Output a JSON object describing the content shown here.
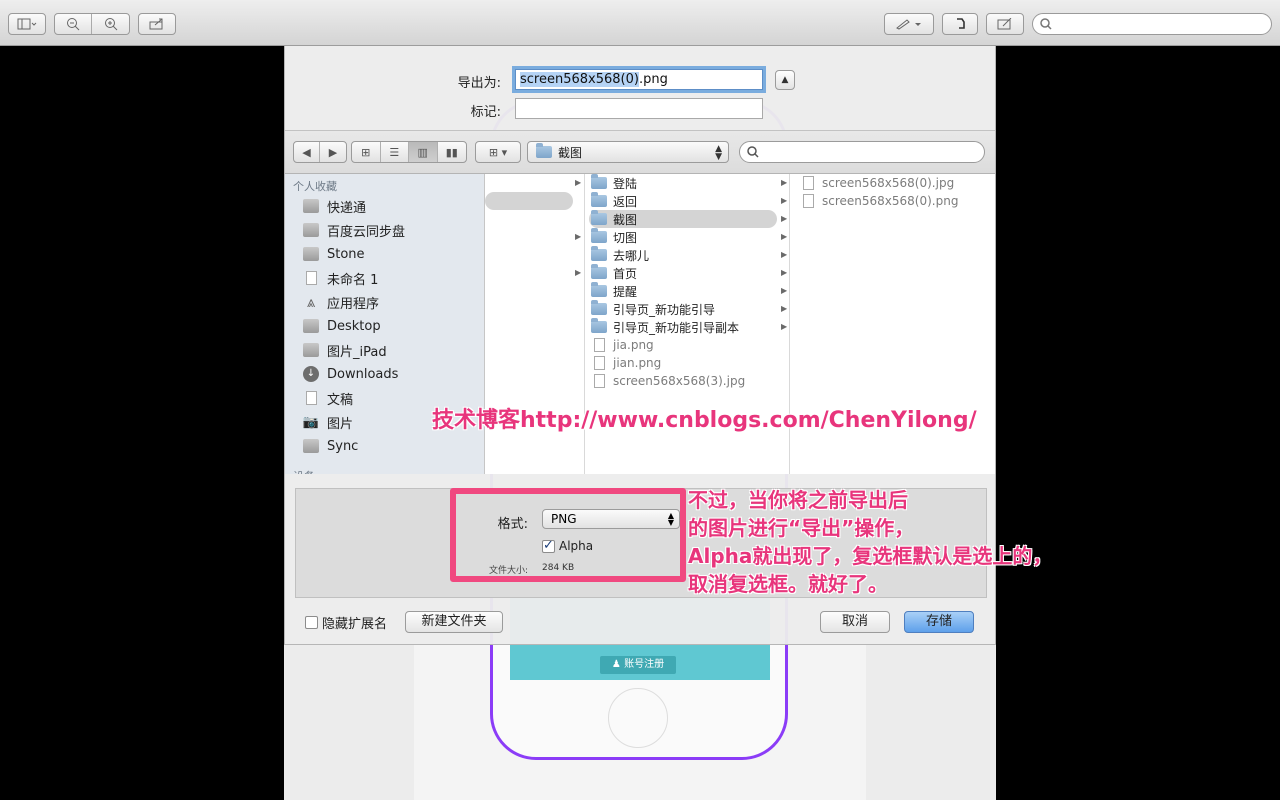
{
  "toolbar": {
    "buttons": [
      "sidebar-toggle",
      "zoom-out",
      "zoom-in",
      "share",
      "markup",
      "rotate",
      "annotate"
    ]
  },
  "sheet": {
    "save_as_label": "导出为:",
    "save_as_selected": "screen568x568(0)",
    "save_as_rest": ".png",
    "tags_label": "标记:",
    "tags_value": "",
    "path": "截图",
    "sidebar": {
      "favorites_header": "个人收藏",
      "devices_header": "设备",
      "items": [
        {
          "label": "快递通",
          "icon": "folder-icon"
        },
        {
          "label": "百度云同步盘",
          "icon": "folder-icon"
        },
        {
          "label": "Stone",
          "icon": "folder-icon"
        },
        {
          "label": "未命名 1",
          "icon": "document-icon"
        },
        {
          "label": "应用程序",
          "icon": "applications-icon"
        },
        {
          "label": "Desktop",
          "icon": "desktop-icon"
        },
        {
          "label": "图片_iPad",
          "icon": "folder-icon"
        },
        {
          "label": "Downloads",
          "icon": "downloads-icon"
        },
        {
          "label": "文稿",
          "icon": "documents-icon"
        },
        {
          "label": "图片",
          "icon": "camera-icon"
        },
        {
          "label": "Sync",
          "icon": "folder-icon"
        }
      ]
    },
    "column2": [
      {
        "label": "登陆",
        "type": "folder",
        "arrow": true
      },
      {
        "label": "返回",
        "type": "folder",
        "arrow": true
      },
      {
        "label": "截图",
        "type": "folder",
        "arrow": true,
        "selected": true
      },
      {
        "label": "切图",
        "type": "folder",
        "arrow": true
      },
      {
        "label": "去哪儿",
        "type": "folder",
        "arrow": true
      },
      {
        "label": "首页",
        "type": "folder",
        "arrow": true
      },
      {
        "label": "提醒",
        "type": "folder",
        "arrow": true
      },
      {
        "label": "引导页_新功能引导",
        "type": "folder",
        "arrow": true
      },
      {
        "label": "引导页_新功能引导副本",
        "type": "folder",
        "arrow": true
      },
      {
        "label": "jia.png",
        "type": "file",
        "dim": true
      },
      {
        "label": "jian.png",
        "type": "file",
        "dim": true
      },
      {
        "label": "screen568x568(3).jpg",
        "type": "file",
        "dim": true
      }
    ],
    "column3": [
      {
        "label": "screen568x568(0).jpg"
      },
      {
        "label": "screen568x568(0).png"
      }
    ],
    "format_label": "格式:",
    "format_value": "PNG",
    "alpha_label": "Alpha",
    "alpha_checked": true,
    "filesize_label": "文件大小:",
    "filesize_value": "284 KB",
    "hide_ext_label": "隐藏扩展名",
    "new_folder_label": "新建文件夹",
    "cancel_label": "取消",
    "save_label": "存储"
  },
  "watermark": "技术博客http://www.cnblogs.com/ChenYilong/",
  "annotation": {
    "lines": [
      "不过，当你将之前导出后",
      "的图片进行“导出”操作，",
      "Alpha就出现了，复选框默认是选上的，",
      "取消复选框。就好了。"
    ]
  },
  "background_doc": {
    "phone_button_label": "账号注册"
  }
}
